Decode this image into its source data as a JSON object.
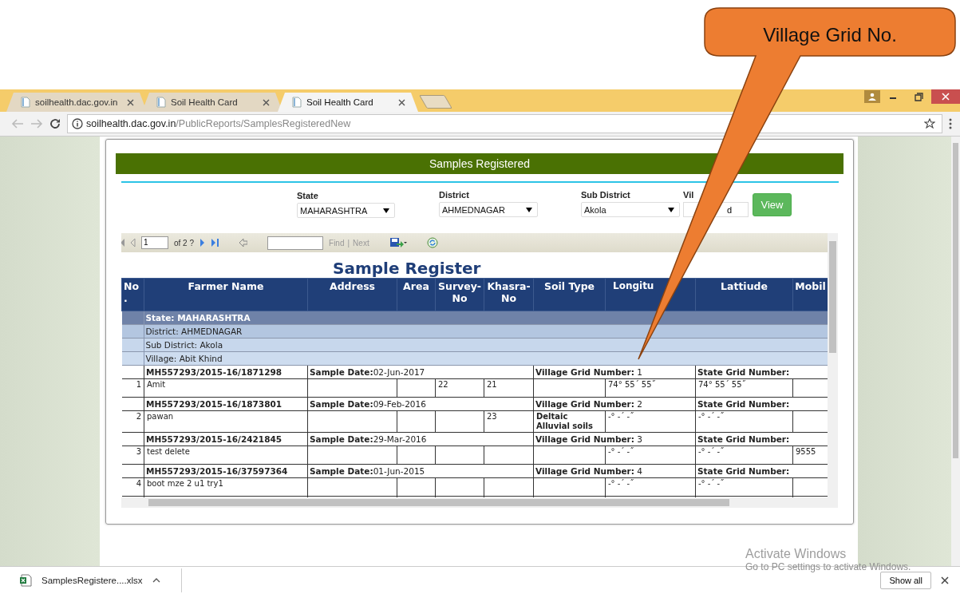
{
  "callout": {
    "text": "Village Grid No."
  },
  "browser": {
    "tabs": [
      {
        "title": "soilhealth.dac.gov.in",
        "selected": false
      },
      {
        "title": "Soil Health Card",
        "selected": false
      },
      {
        "title": "Soil Health Card",
        "selected": true
      }
    ],
    "url": {
      "host": "soilhealth.dac.gov.in",
      "path": "/PublicReports/SamplesRegisteredNew"
    }
  },
  "page": {
    "banner": "Samples Registered",
    "filters": [
      {
        "kind": "select",
        "label": "State",
        "value": "MAHARASHTRA"
      },
      {
        "kind": "select",
        "label": "District",
        "value": "AHMEDNAGAR"
      },
      {
        "kind": "select",
        "label": "Sub District",
        "value": "Akola"
      },
      {
        "kind": "text",
        "label": "Vil",
        "value": "d"
      }
    ],
    "view_button": "View",
    "toolbar": {
      "page": "1",
      "page_count": "of 2 ?",
      "find_link": "Find",
      "separator": "|",
      "next_link": "Next"
    },
    "report_title": "Sample Register",
    "table": {
      "columns": [
        "No.",
        "Farmer Name",
        "Address",
        "Area",
        "Survey-No",
        "Khasra-No",
        "Soil Type",
        "Longitu",
        "Lattiude",
        "Mobil"
      ],
      "groups": [
        "State: MAHARASHTRA",
        "District: AHMEDNAGAR",
        "Sub District: Akola",
        "Village: Abit Khind"
      ],
      "records": [
        {
          "sample_id": "MH557293/2015-16/1871298",
          "sample_date": "**Sample Date:**02-Jun-2017",
          "village_grid": "**Village Grid Number:** 1",
          "state_grid": "State Grid Number:",
          "cells": {
            "no": "1",
            "farmer_name": "Amit",
            "survey_no": "22",
            "khasra_no": "21",
            "longitude": "74° 55´ 55˝",
            "latitude": "74° 55´ 55˝"
          }
        },
        {
          "sample_id": "MH557293/2015-16/1873801",
          "sample_date": "**Sample Date:**09-Feb-2016",
          "village_grid": "**Village Grid Number:** 2",
          "state_grid": "State Grid Number:",
          "cells": {
            "no": "2",
            "farmer_name": "pawan",
            "khasra_no": "23",
            "soil_type": "Deltaic Alluvial soils",
            "longitude": "-° -´ -˝",
            "latitude": "-° -´ -˝"
          }
        },
        {
          "sample_id": "MH557293/2015-16/2421845",
          "sample_date": "**Sample Date:**29-Mar-2016",
          "village_grid": "**Village Grid Number:** 3",
          "state_grid": "State Grid Number:",
          "cells": {
            "no": "3",
            "farmer_name": "test delete",
            "longitude": "-° -´ -˝",
            "latitude": "-° -´ -˝",
            "mobile": "9555"
          }
        },
        {
          "sample_id": "MH557293/2015-16/37597364",
          "sample_date": "**Sample Date:**01-Jun-2015",
          "village_grid": "**Village Grid Number:** 4",
          "state_grid": "State Grid Number:",
          "cells": {
            "no": "4",
            "farmer_name": "boot mze 2 u1 try1",
            "longitude": "-° -´ -˝",
            "latitude": "-° -´ -˝"
          }
        }
      ]
    }
  },
  "downloads": {
    "file": "SamplesRegistere....xlsx",
    "show_all": "Show all"
  },
  "os_notice": {
    "title": "Activate Windows",
    "subtitle": "Go to PC settings to activate Windows."
  }
}
